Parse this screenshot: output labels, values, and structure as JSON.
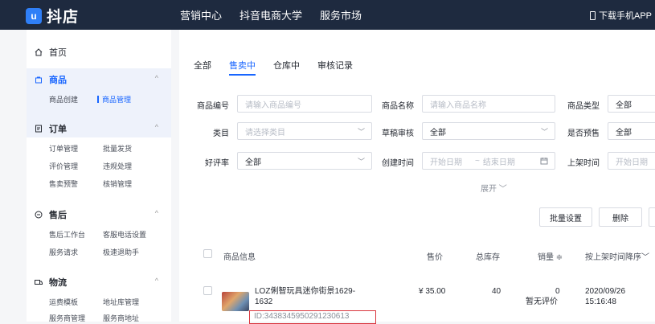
{
  "topbar": {
    "logo_glyph": "u",
    "brand": "抖店",
    "nav": [
      "营销中心",
      "抖音电商大学",
      "服务市场"
    ],
    "download": "下载手机APP"
  },
  "sidebar": {
    "home": "首页",
    "goods": {
      "title": "商品",
      "subs": [
        "商品创建",
        "商品管理"
      ]
    },
    "orders": {
      "title": "订单",
      "subs": [
        "订单管理",
        "批量发货",
        "评价管理",
        "违规处理",
        "售卖预警",
        "核销管理"
      ]
    },
    "aftersale": {
      "title": "售后",
      "subs": [
        "售后工作台",
        "客服电话设置",
        "服务请求",
        "极速退助手"
      ]
    },
    "logistics": {
      "title": "物流",
      "subs": [
        "运费模板",
        "地址库管理",
        "服务商管理",
        "服务商地址"
      ]
    }
  },
  "tabs": [
    "全部",
    "售卖中",
    "仓库中",
    "审核记录"
  ],
  "filters": {
    "goods_no_label": "商品编号",
    "goods_no_ph": "请输入商品编号",
    "goods_name_label": "商品名称",
    "goods_name_ph": "请输入商品名称",
    "goods_type_label": "商品类型",
    "goods_type_val": "全部",
    "category_label": "类目",
    "category_ph": "请选择类目",
    "draft_label": "草稿审核",
    "draft_val": "全部",
    "presale_label": "是否预售",
    "presale_val": "全部",
    "rating_label": "好评率",
    "rating_val": "全部",
    "created_label": "创建时间",
    "start_ph": "开始日期",
    "sep": "~",
    "end_ph": "结束日期",
    "listed_label": "上架时间",
    "listed_start_ph": "开始日期",
    "expand": "展开"
  },
  "actions": {
    "batch": "批量设置",
    "delete": "删除"
  },
  "table": {
    "headers": {
      "info": "商品信息",
      "price": "售价",
      "stock": "总库存",
      "sales": "销量 ≑",
      "sort": "按上架时间降序"
    },
    "row": {
      "name": "LOZ俐智玩具迷你街景1629-1632",
      "id": "ID:3438345950291230613",
      "price": "¥ 35.00",
      "stock": "40",
      "sales": "0",
      "sales_note": "暂无评价",
      "date": "2020/09/26",
      "time": "15:16:48"
    }
  }
}
